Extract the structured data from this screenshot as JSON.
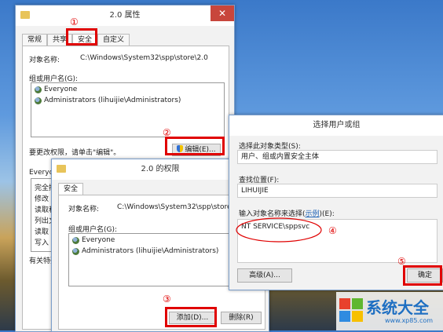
{
  "annotations": {
    "n1": "①",
    "n2": "②",
    "n3": "③",
    "n4": "④",
    "n5": "⑤"
  },
  "props": {
    "title": "2.0 属性",
    "tabs": [
      "常规",
      "共享",
      "安全",
      "自定义"
    ],
    "object_label": "对象名称:",
    "object_value": "C:\\Windows\\System32\\spp\\store\\2.0",
    "groups_label": "组或用户名(G):",
    "users": [
      "Everyone",
      "Administrators (lihuijie\\Administrators)"
    ],
    "change_perm_text": "要更改权限，请单击\"编辑\"。",
    "edit_button": "编辑(E)...",
    "perm_header": "Everyo",
    "perm_rows": [
      "完全控",
      "修改",
      "读取和",
      "列出文",
      "读取",
      "写入"
    ],
    "special_text": "有关特殊"
  },
  "perm": {
    "title": "2.0 的权限",
    "tab": "安全",
    "object_label": "对象名称:",
    "object_value": "C:\\Windows\\System32\\spp\\store\\2.0",
    "groups_label": "组或用户名(G):",
    "users": [
      "Everyone",
      "Administrators (lihuijie\\Administrators)"
    ],
    "add_button": "添加(D)...",
    "remove_button": "删除(R)"
  },
  "select": {
    "title": "选择用户或组",
    "type_label": "选择此对象类型(S):",
    "type_value": "用户、组或内置安全主体",
    "location_label": "查找位置(F):",
    "location_value": "LIHUIJIE",
    "enter_label_prefix": "输入对象名称来选择(",
    "enter_label_link": "示例",
    "enter_label_suffix": ")(E):",
    "input_value": "NT SERVICE\\sppsvc",
    "advanced_button": "高级(A)...",
    "ok_button": "确定"
  },
  "watermark": {
    "text": "系统大全",
    "sub": "www.xp85.com"
  }
}
